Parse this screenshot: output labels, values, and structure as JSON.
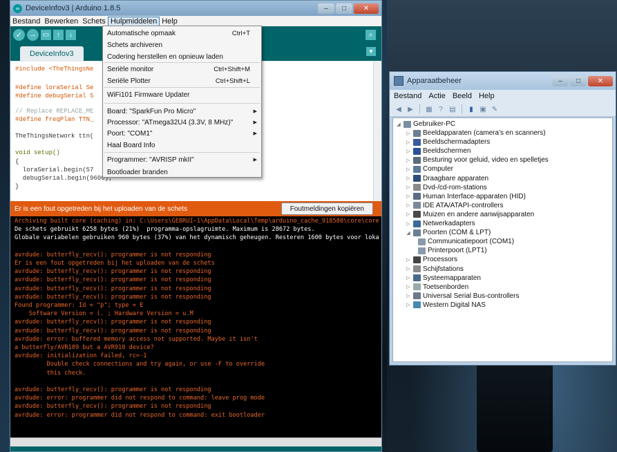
{
  "arduino": {
    "title": "DeviceInfov3 | Arduino 1.8.5",
    "menubar": [
      "Bestand",
      "Bewerken",
      "Schets",
      "Hulpmiddelen",
      "Help"
    ],
    "open_menu": "Hulpmiddelen",
    "tab": "DeviceInfov3",
    "code": [
      "#include <TheThingsNe",
      "#define loraSerial Se",
      "#define debugSerial S",
      "// Replace REPLACE_ME",
      "#define freqPlan TTN_",
      "TheThingsNetwork ttn(",
      "void setup()",
      "{",
      "  loraSerial.begin(57",
      "  debugSerial.begin(9600);",
      "}"
    ],
    "status_message": "Er is een fout opgetreden bij het uploaden van de schets",
    "copy_errors_button": "Foutmeldingen kopiëren",
    "console": [
      {
        "text": "Archiving built core (caching) in: C:\\Users\\GEBRUI~1\\AppData\\Local\\Temp\\arduino_cache_918580\\core\\core",
        "color": "orange"
      },
      {
        "text": "De schets gebruikt 6258 bytes (21%)  programma-opslagruimte. Maximum is 28672 bytes.",
        "color": "white"
      },
      {
        "text": "Globale variabelen gebruiken 960 bytes (37%) van het dynamisch geheugen. Resteren 1600 bytes voor loka",
        "color": "white"
      },
      {
        "text": "",
        "color": "white"
      },
      {
        "text": "avrdude: butterfly_recv(): programmer is not responding",
        "color": "orange"
      },
      {
        "text": "Er is een fout opgetreden bij het uploaden van de schets",
        "color": "orange"
      },
      {
        "text": "avrdude: butterfly_recv(): programmer is not responding",
        "color": "orange"
      },
      {
        "text": "avrdude: butterfly_recv(): programmer is not responding",
        "color": "orange"
      },
      {
        "text": "avrdude: butterfly_recv(): programmer is not responding",
        "color": "orange"
      },
      {
        "text": "avrdude: butterfly_recv(): programmer is not responding",
        "color": "orange"
      },
      {
        "text": "Found programmer: Id = \"p\"; type = E",
        "color": "orange"
      },
      {
        "text": "    Software Version = (. ; Hardware Version = u.M",
        "color": "orange"
      },
      {
        "text": "avrdude: butterfly_recv(): programmer is not responding",
        "color": "orange"
      },
      {
        "text": "avrdude: butterfly_recv(): programmer is not responding",
        "color": "orange"
      },
      {
        "text": "avrdude: error: buffered memory access not supported. Maybe it isn't",
        "color": "orange"
      },
      {
        "text": "a butterfly/AVR109 but a AVR910 device?",
        "color": "orange"
      },
      {
        "text": "avrdude: initialization failed, rc=-1",
        "color": "orange"
      },
      {
        "text": "         Double check connections and try again, or use -F to override",
        "color": "orange"
      },
      {
        "text": "         this check.",
        "color": "orange"
      },
      {
        "text": "",
        "color": "white"
      },
      {
        "text": "avrdude: butterfly_recv(): programmer is not responding",
        "color": "orange"
      },
      {
        "text": "avrdude: error: programmer did not respond to command: leave prog mode",
        "color": "orange"
      },
      {
        "text": "avrdude: butterfly_recv(): programmer is not responding",
        "color": "orange"
      },
      {
        "text": "avrdude: error: programmer did not respond to command: exit bootloader",
        "color": "orange"
      }
    ],
    "colors": {
      "teal": "#006468",
      "error_bar": "#e05a10",
      "console_text": "#e8672a"
    }
  },
  "tools_menu": {
    "items": [
      {
        "label": "Automatische opmaak",
        "shortcut": "Ctrl+T",
        "submenu": false
      },
      {
        "label": "Schets archiveren",
        "shortcut": "",
        "submenu": false
      },
      {
        "label": "Codering herstellen en opnieuw laden",
        "shortcut": "",
        "submenu": false
      },
      {
        "label": "Seriële monitor",
        "shortcut": "Ctrl+Shift+M",
        "submenu": false
      },
      {
        "label": "Seriële Plotter",
        "shortcut": "Ctrl+Shift+L",
        "submenu": false
      },
      {
        "label": "WiFi101 Firmware Updater",
        "shortcut": "",
        "submenu": false
      },
      {
        "label": "Board: \"SparkFun Pro Micro\"",
        "shortcut": "",
        "submenu": true
      },
      {
        "label": "Processor: \"ATmega32U4 (3.3V, 8 MHz)\"",
        "shortcut": "",
        "submenu": true
      },
      {
        "label": "Poort: \"COM1\"",
        "shortcut": "",
        "submenu": true
      },
      {
        "label": "Haal Board Info",
        "shortcut": "",
        "submenu": false
      },
      {
        "label": "Programmer: \"AVRISP mkII\"",
        "shortcut": "",
        "submenu": true
      },
      {
        "label": "Bootloader branden",
        "shortcut": "",
        "submenu": false
      }
    ]
  },
  "device_manager": {
    "title": "Apparaatbeheer",
    "menubar": [
      "Bestand",
      "Actie",
      "Beeld",
      "Help"
    ],
    "root": "Gebruiker-PC",
    "categories": [
      {
        "label": "Beeldapparaten (camera's en scanners)",
        "icon": "camera-icon",
        "expanded": false
      },
      {
        "label": "Beeldschermadapters",
        "icon": "display-adapter-icon",
        "expanded": false
      },
      {
        "label": "Beeldschermen",
        "icon": "monitor-icon",
        "expanded": false
      },
      {
        "label": "Besturing voor geluid, video en spelletjes",
        "icon": "speaker-icon",
        "expanded": false
      },
      {
        "label": "Computer",
        "icon": "computer-icon",
        "expanded": false
      },
      {
        "label": "Draagbare apparaten",
        "icon": "portable-device-icon",
        "expanded": false
      },
      {
        "label": "Dvd-/cd-rom-stations",
        "icon": "disc-drive-icon",
        "expanded": false
      },
      {
        "label": "Human Interface-apparaten (HID)",
        "icon": "hid-icon",
        "expanded": false
      },
      {
        "label": "IDE ATA/ATAPI-controllers",
        "icon": "ide-controller-icon",
        "expanded": false
      },
      {
        "label": "Muizen en andere aanwijsapparaten",
        "icon": "mouse-icon",
        "expanded": false
      },
      {
        "label": "Netwerkadapters",
        "icon": "network-adapter-icon",
        "expanded": false
      },
      {
        "label": "Poorten (COM & LPT)",
        "icon": "port-icon",
        "expanded": true
      },
      {
        "label": "Processors",
        "icon": "processor-icon",
        "expanded": false
      },
      {
        "label": "Schijfstations",
        "icon": "disk-drive-icon",
        "expanded": false
      },
      {
        "label": "Systeemapparaten",
        "icon": "system-device-icon",
        "expanded": false
      },
      {
        "label": "Toetsenborden",
        "icon": "keyboard-icon",
        "expanded": false
      },
      {
        "label": "Universal Serial Bus-controllers",
        "icon": "usb-icon",
        "expanded": false
      },
      {
        "label": "Western Digital NAS",
        "icon": "nas-icon",
        "expanded": false
      }
    ],
    "ports_children": [
      "Communicatiepoort (COM1)",
      "Printerpoort (LPT1)"
    ]
  }
}
